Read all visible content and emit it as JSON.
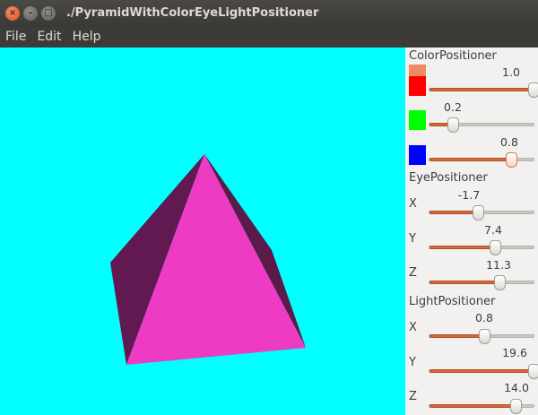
{
  "window": {
    "title": "./PyramidWithColorEyeLightPositioner",
    "close_icon": "×",
    "minimize_icon": "–",
    "maximize_icon": "□"
  },
  "menu": [
    "File",
    "Edit",
    "Help"
  ],
  "scene": {
    "background": "#00ffff",
    "pyramid_front_color": "#ee3bc4",
    "pyramid_left_color": "#601951",
    "pyramid_right_color": "#5b1a4a"
  },
  "color_positioner": {
    "label": "ColorPositioner",
    "swatch_colors": [
      "#ff0000",
      "#00ff00",
      "#0000ff"
    ],
    "top_swatch_color": "#f08a63",
    "sliders": [
      {
        "value": "1.0",
        "fraction": 0.98
      },
      {
        "value": "0.2",
        "fraction": 0.22
      },
      {
        "value": "0.8",
        "fraction": 0.77
      }
    ]
  },
  "eye_positioner": {
    "label": "EyePositioner",
    "sliders": [
      {
        "axis": "X",
        "value": "-1.7",
        "fraction": 0.46
      },
      {
        "axis": "Y",
        "value": "7.4",
        "fraction": 0.62
      },
      {
        "axis": "Z",
        "value": "11.3",
        "fraction": 0.66
      }
    ]
  },
  "light_positioner": {
    "label": "LightPositioner",
    "sliders": [
      {
        "axis": "X",
        "value": "0.8",
        "fraction": 0.52
      },
      {
        "axis": "Y",
        "value": "19.6",
        "fraction": 0.98
      },
      {
        "axis": "Z",
        "value": "14.0",
        "fraction": 0.81
      }
    ]
  }
}
